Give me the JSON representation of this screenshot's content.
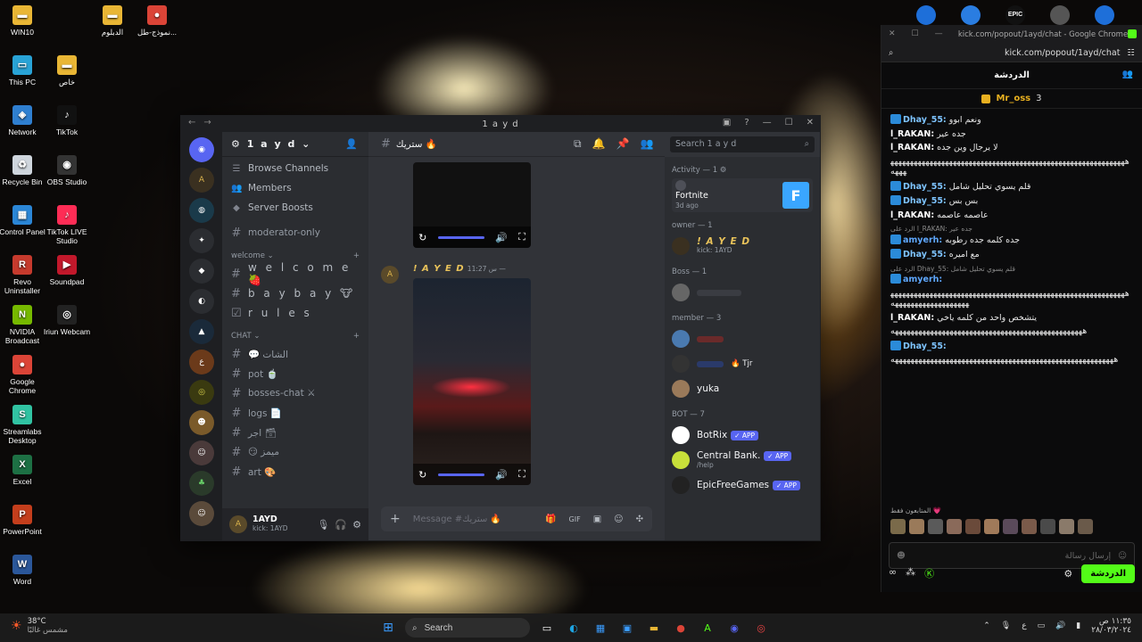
{
  "desktop": {
    "left_icons": [
      {
        "label": "WIN10",
        "name": "win10-folder-icon",
        "color": "#e9b635",
        "glyph": "▬"
      },
      {
        "label": "This PC",
        "name": "this-pc-icon",
        "color": "#29a3d6",
        "glyph": "▭"
      },
      {
        "label": "Network",
        "name": "network-icon",
        "color": "#2f7fd0",
        "glyph": "◈"
      },
      {
        "label": "Recycle Bin",
        "name": "recycle-bin-icon",
        "color": "#cfd6dd",
        "glyph": "♻"
      },
      {
        "label": "Control Panel",
        "name": "control-panel-icon",
        "color": "#2b86d6",
        "glyph": "▦"
      },
      {
        "label": "Revo Uninstaller",
        "name": "revo-uninstaller-icon",
        "color": "#c63a2d",
        "glyph": "R"
      },
      {
        "label": "NVIDIA Broadcast",
        "name": "nvidia-broadcast-icon",
        "color": "#76b900",
        "glyph": "N"
      },
      {
        "label": "Google Chrome",
        "name": "google-chrome-icon",
        "color": "#db4437",
        "glyph": "●"
      },
      {
        "label": "Streamlabs Desktop",
        "name": "streamlabs-icon",
        "color": "#31c3a2",
        "glyph": "S"
      },
      {
        "label": "Excel",
        "name": "excel-icon",
        "color": "#1d7044",
        "glyph": "X"
      },
      {
        "label": "PowerPoint",
        "name": "powerpoint-icon",
        "color": "#c43e1c",
        "glyph": "P"
      },
      {
        "label": "Word",
        "name": "word-icon",
        "color": "#2b579a",
        "glyph": "W"
      }
    ],
    "second_icons": [
      {
        "label": "خاص",
        "name": "khas-folder-icon",
        "color": "#e9b635",
        "glyph": "▬"
      },
      {
        "label": "TikTok",
        "name": "tiktok-icon",
        "color": "#111111",
        "glyph": "♪"
      },
      {
        "label": "OBS Studio",
        "name": "obs-studio-icon",
        "color": "#333333",
        "glyph": "◉"
      },
      {
        "label": "TikTok LIVE Studio",
        "name": "tiktok-live-studio-icon",
        "color": "#fe2c55",
        "glyph": "♪"
      },
      {
        "label": "Soundpad",
        "name": "soundpad-icon",
        "color": "#c2182b",
        "glyph": "▶"
      },
      {
        "label": "Iriun Webcam",
        "name": "iriun-webcam-icon",
        "color": "#222222",
        "glyph": "◎"
      }
    ],
    "top_icons": [
      {
        "label": "الدبلوم",
        "name": "diploma-folder-icon",
        "color": "#e9b635",
        "glyph": "▬"
      },
      {
        "label": "نموذج-طل...",
        "name": "form-file-icon",
        "color": "#db4437",
        "glyph": "●"
      }
    ],
    "top_right_icons": [
      {
        "name": "app-tray-icon-1",
        "color": "#1e6fd9"
      },
      {
        "name": "app-tray-icon-2",
        "color": "#2a7de1"
      },
      {
        "name": "epic-games-icon",
        "color": "#111111",
        "label": "EPIC"
      },
      {
        "name": "app-tray-icon-4",
        "color": "#555555"
      },
      {
        "name": "app-tray-icon-5",
        "color": "#1e6fd9"
      }
    ]
  },
  "discord": {
    "window_title": "1 a y d",
    "guild_name": "1 a y d",
    "nav": [
      {
        "label": "Browse Channels",
        "icon": "browse-channels-icon",
        "glyph": "☰"
      },
      {
        "label": "Members",
        "icon": "members-icon",
        "glyph": "👥"
      },
      {
        "label": "Server Boosts",
        "icon": "server-boost-icon",
        "glyph": "◆"
      }
    ],
    "channels_top": [
      {
        "label": "moderator-only"
      }
    ],
    "category_welcome": "welcome",
    "welcome_channels": [
      {
        "label": "w e l c o m e 🍓",
        "glyph": "#"
      },
      {
        "label": "b a y b a y 🐮",
        "glyph": "#"
      },
      {
        "label": "r u l e s",
        "glyph": "☑"
      }
    ],
    "category_chat": "CHAT",
    "chat_channels": [
      {
        "label": "💬 الشات"
      },
      {
        "label": "pot 🍵"
      },
      {
        "label": "bosses-chat ⚔"
      },
      {
        "label": "logs 📄"
      },
      {
        "label": "اجر 🗃"
      },
      {
        "label": "😏 ميمز"
      },
      {
        "label": "art 🎨"
      }
    ],
    "user": {
      "name": "1AYD",
      "status": "kick: 1AYD"
    },
    "channel_header": "ستريك 🔥",
    "search_placeholder": "Search 1 a y d",
    "message": {
      "author": "! A Y E D",
      "time": "س 11:27 —"
    },
    "message_input_placeholder": "Message #ستريك 🔥",
    "members": {
      "activity_label": "Activity — 1 ⚙",
      "activity_game": "Fortnite",
      "activity_time": "3d ago",
      "owner_label": "owner — 1",
      "owner_name": "! A Y E D",
      "owner_status": "kick: 1AYD",
      "boss_label": "Boss — 1",
      "member_label": "member — 3",
      "member_tag": "🔥 Tjr",
      "member_name": "yuka",
      "bot_label": "BOT — 7",
      "bots": [
        {
          "name": "BotRix",
          "badge": "✓ APP",
          "sub": ""
        },
        {
          "name": "Central Bank.",
          "badge": "✓ APP",
          "sub": "/help"
        },
        {
          "name": "EpicFreeGames",
          "badge": "✓ APP",
          "sub": ""
        }
      ]
    }
  },
  "kick": {
    "window_title": "kick.com/popout/1ayd/chat - Google Chrome",
    "url": "kick.com/popout/1ayd/chat",
    "chat_header": "الدردشة",
    "pinned_user": "Mr_oss",
    "pinned_count": "3",
    "messages": [
      {
        "user": "Dhay_55:",
        "color": "#7ec4ff",
        "text": "ونعم ابوو",
        "badge": true,
        "reply": ""
      },
      {
        "user": "l_RAKAN:",
        "color": "#ffffff",
        "text": "جده عير",
        "badge": false,
        "reply": ""
      },
      {
        "user": "l_RAKAN:",
        "color": "#ffffff",
        "text": "لا يرجال وين جده",
        "badge": false,
        "reply": ""
      },
      {
        "user": "",
        "color": "#ffffff",
        "text": "ههههههههههههههههههههههههههههههههههههههههههههههههههههههههههههههههه",
        "badge": false,
        "reply": ""
      },
      {
        "user": "Dhay_55:",
        "color": "#7ec4ff",
        "text": "قلم يسوي تحليل شامل",
        "badge": true,
        "reply": ""
      },
      {
        "user": "Dhay_55:",
        "color": "#7ec4ff",
        "text": "بس بس",
        "badge": true,
        "reply": ""
      },
      {
        "user": "l_RAKAN:",
        "color": "#ffffff",
        "text": "عاصمه عاصمه",
        "badge": false,
        "reply": ""
      },
      {
        "user": "amyerh:",
        "color": "#5fa8ff",
        "text": "جده كلمه جده رطوبه",
        "badge": true,
        "reply": "الرد على l_RAKAN: جده عير"
      },
      {
        "user": "Dhay_55:",
        "color": "#7ec4ff",
        "text": "مع اميره",
        "badge": true,
        "reply": ""
      },
      {
        "user": "amyerh:",
        "color": "#5fa8ff",
        "text": "",
        "badge": true,
        "reply": "الرد على Dhay_55: قلم يسوي تحليل شامل"
      },
      {
        "user": "",
        "color": "#ffffff",
        "text": "ههههههههههههههههههههههههههههههههههههههههههههههههههههههههههههههههههههههههههههههههه",
        "badge": false,
        "reply": ""
      },
      {
        "user": "l_RAKAN:",
        "color": "#ffffff",
        "text": "يتشخص واحد من كلمه ياخي",
        "badge": false,
        "reply": ""
      },
      {
        "user": "",
        "color": "#ffffff",
        "text": "هههههههههههههههههههههههههههههههههههههههههههههههههه",
        "badge": false,
        "reply": ""
      },
      {
        "user": "Dhay_55:",
        "color": "#7ec4ff",
        "text": "",
        "badge": true,
        "reply": ""
      },
      {
        "user": "",
        "color": "#ffffff",
        "text": "هههههههههههههههههههههههههههههههههههههههههههههههههههههههههه",
        "badge": false,
        "reply": ""
      }
    ],
    "subs_label": "المتابعون فقط 💗",
    "input_placeholder": "إرسال رسالة",
    "send_label": "الدردشة"
  },
  "taskbar": {
    "weather_temp": "38°C",
    "weather_desc": "مشمس غالبًا",
    "search_label": "Search",
    "time": "١١:٣٥ ص",
    "date": "٢٨/٠٣/٢٠٢٤",
    "lang": "ع"
  }
}
